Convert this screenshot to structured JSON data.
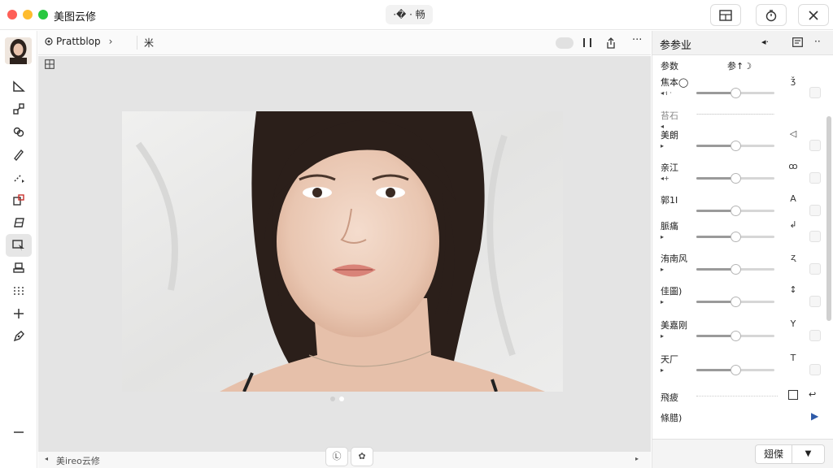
{
  "app": {
    "title": "美图云修",
    "center_label": "·� · 畅"
  },
  "breadcrumb": {
    "label": "Prattblop",
    "sep": "›",
    "extra": "米"
  },
  "status": {
    "left": "美ireo云修"
  },
  "panel": {
    "title": "参参业",
    "header_label": "参数",
    "header_value": "参↑☽",
    "rows": [
      {
        "label": "焦本◯",
        "sub": "◂·ı ·",
        "value": 0.5,
        "icon": "ǯ"
      },
      {
        "label": "苔石",
        "sub": "◂",
        "value": null,
        "icon": ""
      },
      {
        "label": "美朗",
        "sub": "▸",
        "value": 0.5,
        "icon": "◁"
      },
      {
        "label": "亲江",
        "sub": "◂+",
        "value": 0.5,
        "icon": "ꝏ"
      },
      {
        "label": "郭1I",
        "sub": "",
        "value": 0.5,
        "icon": "A"
      },
      {
        "label": "脈痛",
        "sub": "▸",
        "value": 0.5,
        "icon": "↲"
      },
      {
        "label": "洧南风",
        "sub": "▸",
        "value": 0.5,
        "icon": "ʐ"
      },
      {
        "label": "佳圖)",
        "sub": "▸",
        "value": 0.5,
        "icon": "↕"
      },
      {
        "label": "美嘉刚",
        "sub": "▸",
        "value": 0.5,
        "icon": "Y"
      },
      {
        "label": "天厂",
        "sub": "▸",
        "value": 0.5,
        "icon": "T"
      }
    ],
    "extra_label": "飛疲",
    "last_label": "條腊)",
    "footer_button": "翅傑"
  },
  "colors": {
    "accent": "#2e5aa8",
    "canvas": "#e4e4e4"
  }
}
